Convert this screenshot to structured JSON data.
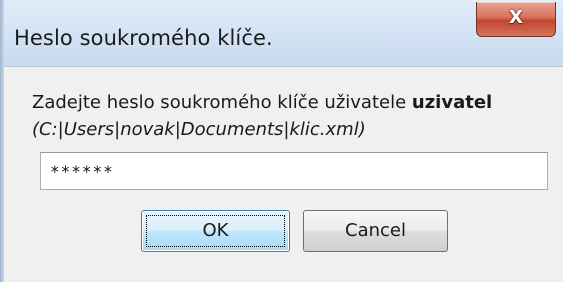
{
  "dialog": {
    "title": "Heslo soukromého klíče.",
    "close_label": "X",
    "message_prefix": "Zadejte heslo soukromého klíče uživatele ",
    "message_user": "uzivatel",
    "path": "(C:|Users|novak|Documents|klic.xml)",
    "password_value": "******",
    "ok_label": "OK",
    "cancel_label": "Cancel"
  },
  "colors": {
    "close_button": "#c4452f",
    "titlebar": "#d3e2f4",
    "ok_focus_border": "#3c7fb1"
  }
}
